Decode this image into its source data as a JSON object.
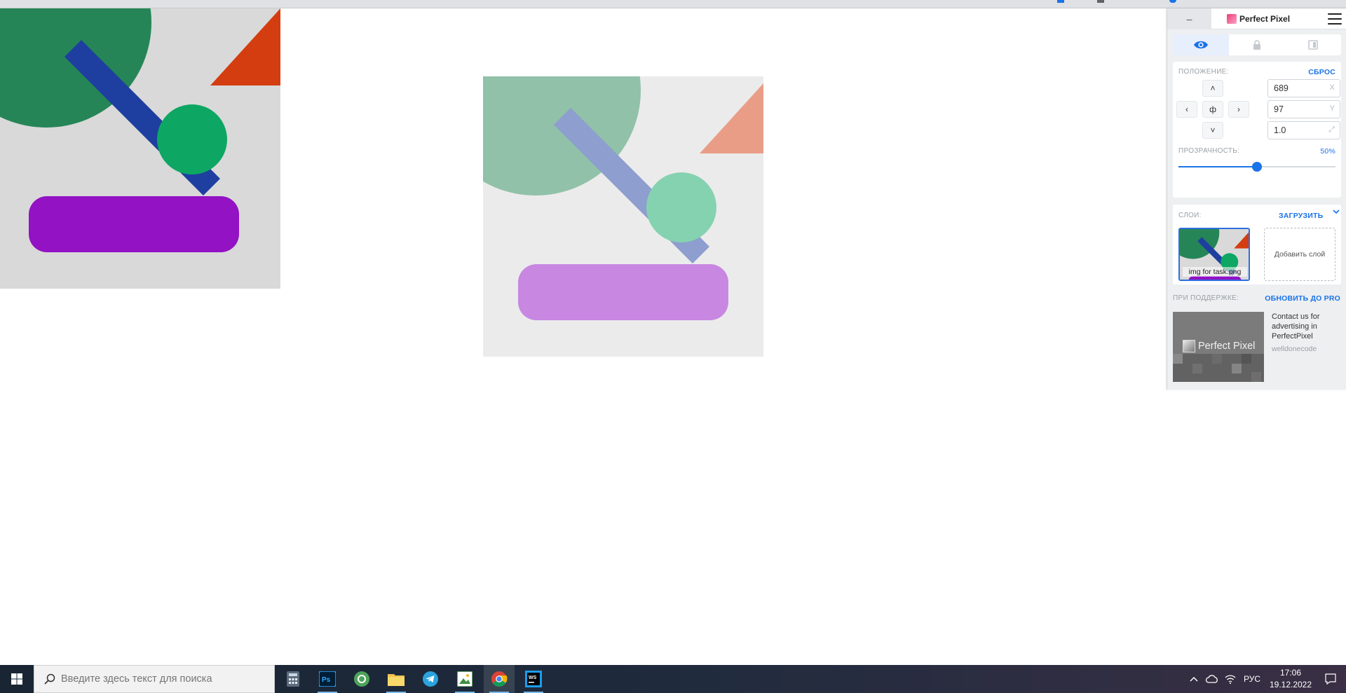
{
  "panel": {
    "minimize_label": "–",
    "title": "Perfect Pixel",
    "tabs": [
      "eye-icon",
      "lock-icon",
      "invert-icon"
    ],
    "position_label": "ПОЛОЖЕНИЕ:",
    "reset_label": "СБРОС",
    "nudge": {
      "up": "˄",
      "down": "˅",
      "left": "‹",
      "right": "›",
      "center": "ф"
    },
    "x_value": "689",
    "x_suffix": "X",
    "y_value": "97",
    "y_suffix": "Y",
    "scale_value": "1.0",
    "scale_suffix": "⤢",
    "opacity_label": "ПРОЗРАЧНОСТЬ:",
    "opacity_value_text": "50%",
    "opacity_fraction": 0.5,
    "layers_label": "СЛОИ:",
    "upload_label": "ЗАГРУЗИТЬ",
    "layer_name": "img for task.png",
    "add_layer_label": "Добавить слой",
    "support_label": "ПРИ ПОДДЕРЖКЕ:",
    "upgrade_label": "ОБНОВИТЬ ДО PRO",
    "ad_image_text": "Perfect Pixel",
    "ad_text": "Contact us for advertising in PerfectPixel",
    "ad_brand": "welldonecode"
  },
  "taskbar": {
    "search_placeholder": "Введите здесь текст для поиска",
    "apps": [
      "calculator",
      "photoshop",
      "sourcetree",
      "file-explorer",
      "telegram",
      "image-viewer",
      "chrome",
      "webstorm"
    ],
    "language": "РУС",
    "time": "17:06",
    "date": "19.12.2022"
  },
  "colors": {
    "accent": "#1a73e8",
    "art_background": "#d9d9d9",
    "big_circle": "#258556",
    "triangle": "#d43d0f",
    "bar": "#1e3fa0",
    "small_circle": "#0da763",
    "pill": "#9212c4"
  }
}
